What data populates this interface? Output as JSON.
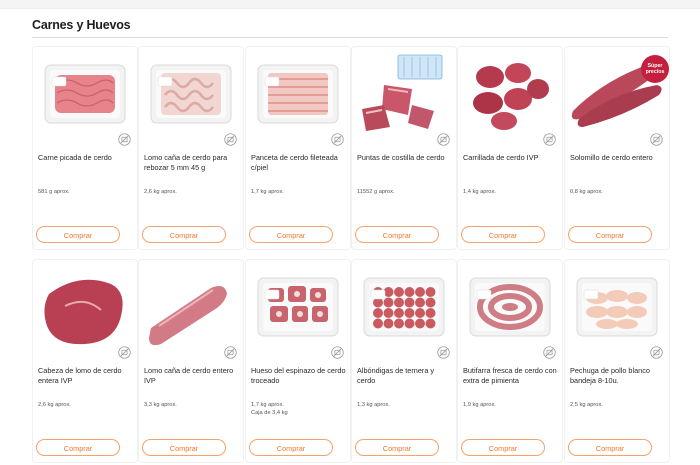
{
  "section": {
    "title": "Carnes y Huevos"
  },
  "button_label": "Comprar",
  "colors": {
    "accent": "#ee7a2c",
    "badge": "#c41f3e"
  },
  "products": [
    {
      "name": "Carne picada de cerdo",
      "weight": "581 g aprox.",
      "weight2": "",
      "image": "minced-pork-tray"
    },
    {
      "name": "Lomo caña de cerdo para rebozar 5 mm 45 g",
      "weight": "2,6 kg aprox.",
      "weight2": "",
      "image": "pork-loin-slices-tray"
    },
    {
      "name": "Panceta de cerdo fileteada c/piel",
      "weight": "1,7 kg aprox.",
      "weight2": "",
      "image": "pork-belly-slices-tray"
    },
    {
      "name": "Puntas de costilla de cerdo",
      "weight": "11552 g aprox.",
      "weight2": "",
      "image": "pork-rib-tips"
    },
    {
      "name": "Carrillada de cerdo IVP",
      "weight": "1,4 kg aprox.",
      "weight2": "",
      "image": "pork-cheeks"
    },
    {
      "name": "Solomillo de cerdo entero",
      "weight": "0,8 kg aprox.",
      "weight2": "",
      "image": "pork-tenderloin",
      "badge": "Súper precios"
    },
    {
      "name": "Cabeza de lomo de cerdo entera IVP",
      "weight": "2,6 kg aprox.",
      "weight2": "",
      "image": "pork-neck"
    },
    {
      "name": "Lomo caña de cerdo entero IVP",
      "weight": "3,3 kg aprox.",
      "weight2": "",
      "image": "pork-loin-whole"
    },
    {
      "name": "Hueso del espinazo de cerdo troceado",
      "weight": "1,7 kg aprox.",
      "weight2": "Caja de 3,4 kg",
      "image": "pork-spine-bones"
    },
    {
      "name": "Albóndigas de ternera y cerdo",
      "weight": "1,3 kg aprox.",
      "weight2": "",
      "image": "meatballs-tray"
    },
    {
      "name": "Butifarra fresca de cerdo con extra de pimienta",
      "weight": "1,9 kg aprox.",
      "weight2": "",
      "image": "sausage-coil-tray"
    },
    {
      "name": "Pechuga de pollo blanco bandeja 8-10u.",
      "weight": "2,5 kg aprox.",
      "weight2": "",
      "image": "chicken-breast-tray"
    }
  ]
}
